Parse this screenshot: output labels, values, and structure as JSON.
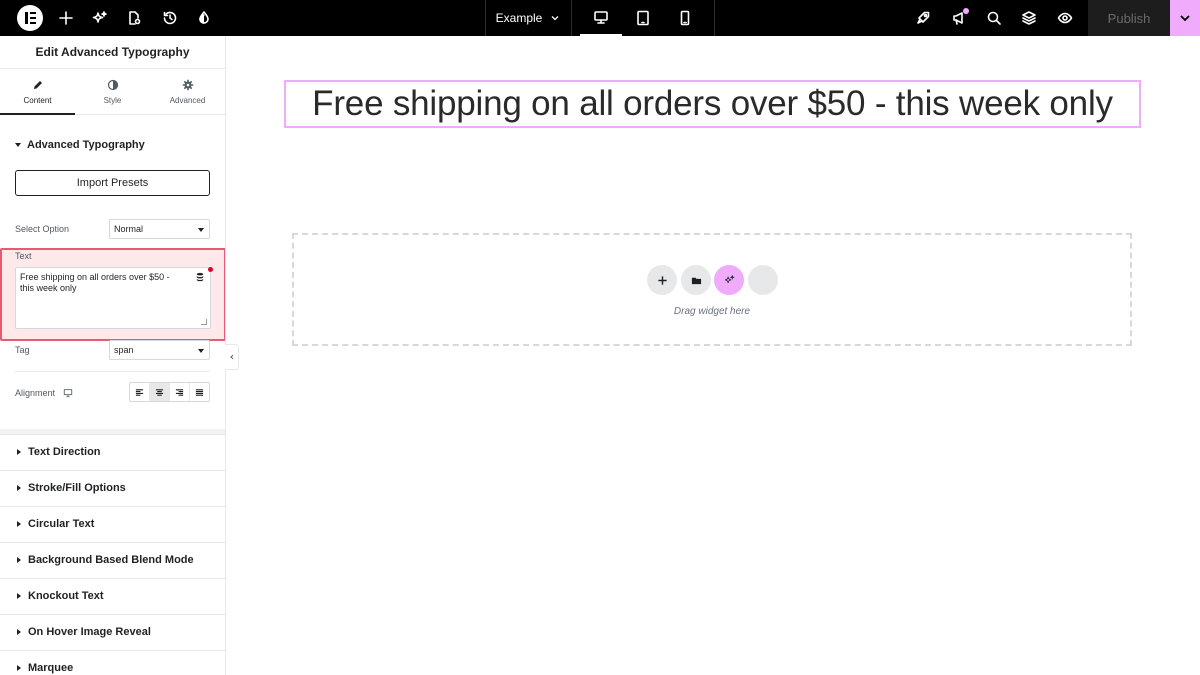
{
  "topbar": {
    "page_name": "Example",
    "publish_label": "Publish"
  },
  "panel": {
    "title": "Edit Advanced Typography",
    "tabs": [
      {
        "label": "Content",
        "icon": "pencil-icon",
        "active": true
      },
      {
        "label": "Style",
        "icon": "half-circle-icon",
        "active": false
      },
      {
        "label": "Advanced",
        "icon": "gear-icon",
        "active": false
      }
    ],
    "section_title": "Advanced Typography",
    "import_label": "Import Presets",
    "select_option": {
      "label": "Select Option",
      "value": "Normal"
    },
    "text": {
      "label": "Text",
      "value": "Free shipping on all orders over $50 - this week only"
    },
    "tag": {
      "label": "Tag",
      "value": "span"
    },
    "alignment": {
      "label": "Alignment",
      "options": [
        "left",
        "center",
        "right",
        "justify"
      ],
      "active": "center"
    },
    "accordions": [
      "Text Direction",
      "Stroke/Fill Options",
      "Circular Text",
      "Background Based Blend Mode",
      "Knockout Text",
      "On Hover Image Reveal",
      "Marquee"
    ]
  },
  "canvas": {
    "heading": "Free shipping on all orders over $50 - this week only",
    "drop_label": "Drag widget here"
  },
  "colors": {
    "accent_pink": "#f0abfc",
    "error_red": "#e75a72",
    "topbar_bg": "#000000"
  }
}
